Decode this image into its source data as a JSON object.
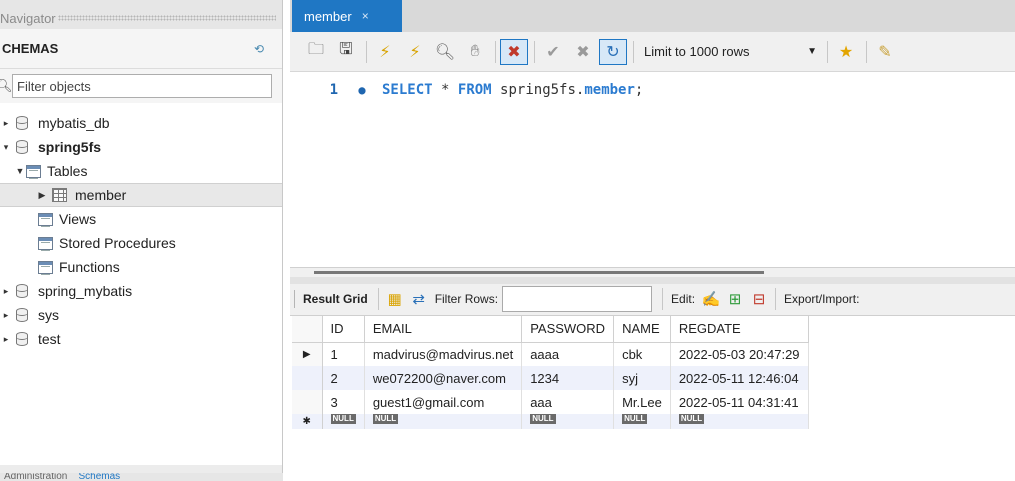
{
  "navigator": {
    "header": "Navigator",
    "schemas_title": "CHEMAS",
    "filter_placeholder": "Filter objects",
    "tree": [
      {
        "label": "mybatis_db",
        "bold": false
      },
      {
        "label": "spring5fs",
        "bold": true
      },
      {
        "label": "Tables"
      },
      {
        "label": "member"
      },
      {
        "label": "Views"
      },
      {
        "label": "Stored Procedures"
      },
      {
        "label": "Functions"
      },
      {
        "label": "spring_mybatis"
      },
      {
        "label": "sys"
      },
      {
        "label": "test"
      }
    ],
    "bottom_tabs": [
      "Administration",
      "Schemas"
    ]
  },
  "editor": {
    "tab_label": "member",
    "tab_close": "×",
    "limit_label": "Limit to 1000 rows",
    "sql": {
      "line_number": "1",
      "select": "SELECT",
      "star": "*",
      "from": "FROM",
      "schema": "spring5fs.",
      "table": "member",
      "semicolon": ";"
    }
  },
  "result": {
    "result_grid_label": "Result Grid",
    "filter_rows_label": "Filter Rows:",
    "edit_label": "Edit:",
    "export_label": "Export/Import:",
    "columns": [
      "ID",
      "EMAIL",
      "PASSWORD",
      "NAME",
      "REGDATE"
    ],
    "rows": [
      [
        "1",
        "madvirus@madvirus.net",
        "aaaa",
        "cbk",
        "2022-05-03 20:47:29"
      ],
      [
        "2",
        "we072200@naver.com",
        "1234",
        "syj",
        "2022-05-11 12:46:04"
      ],
      [
        "3",
        "guest1@gmail.com",
        "aaa",
        "Mr.Lee",
        "2022-05-11 04:31:41"
      ]
    ],
    "null_label": "NULL"
  }
}
